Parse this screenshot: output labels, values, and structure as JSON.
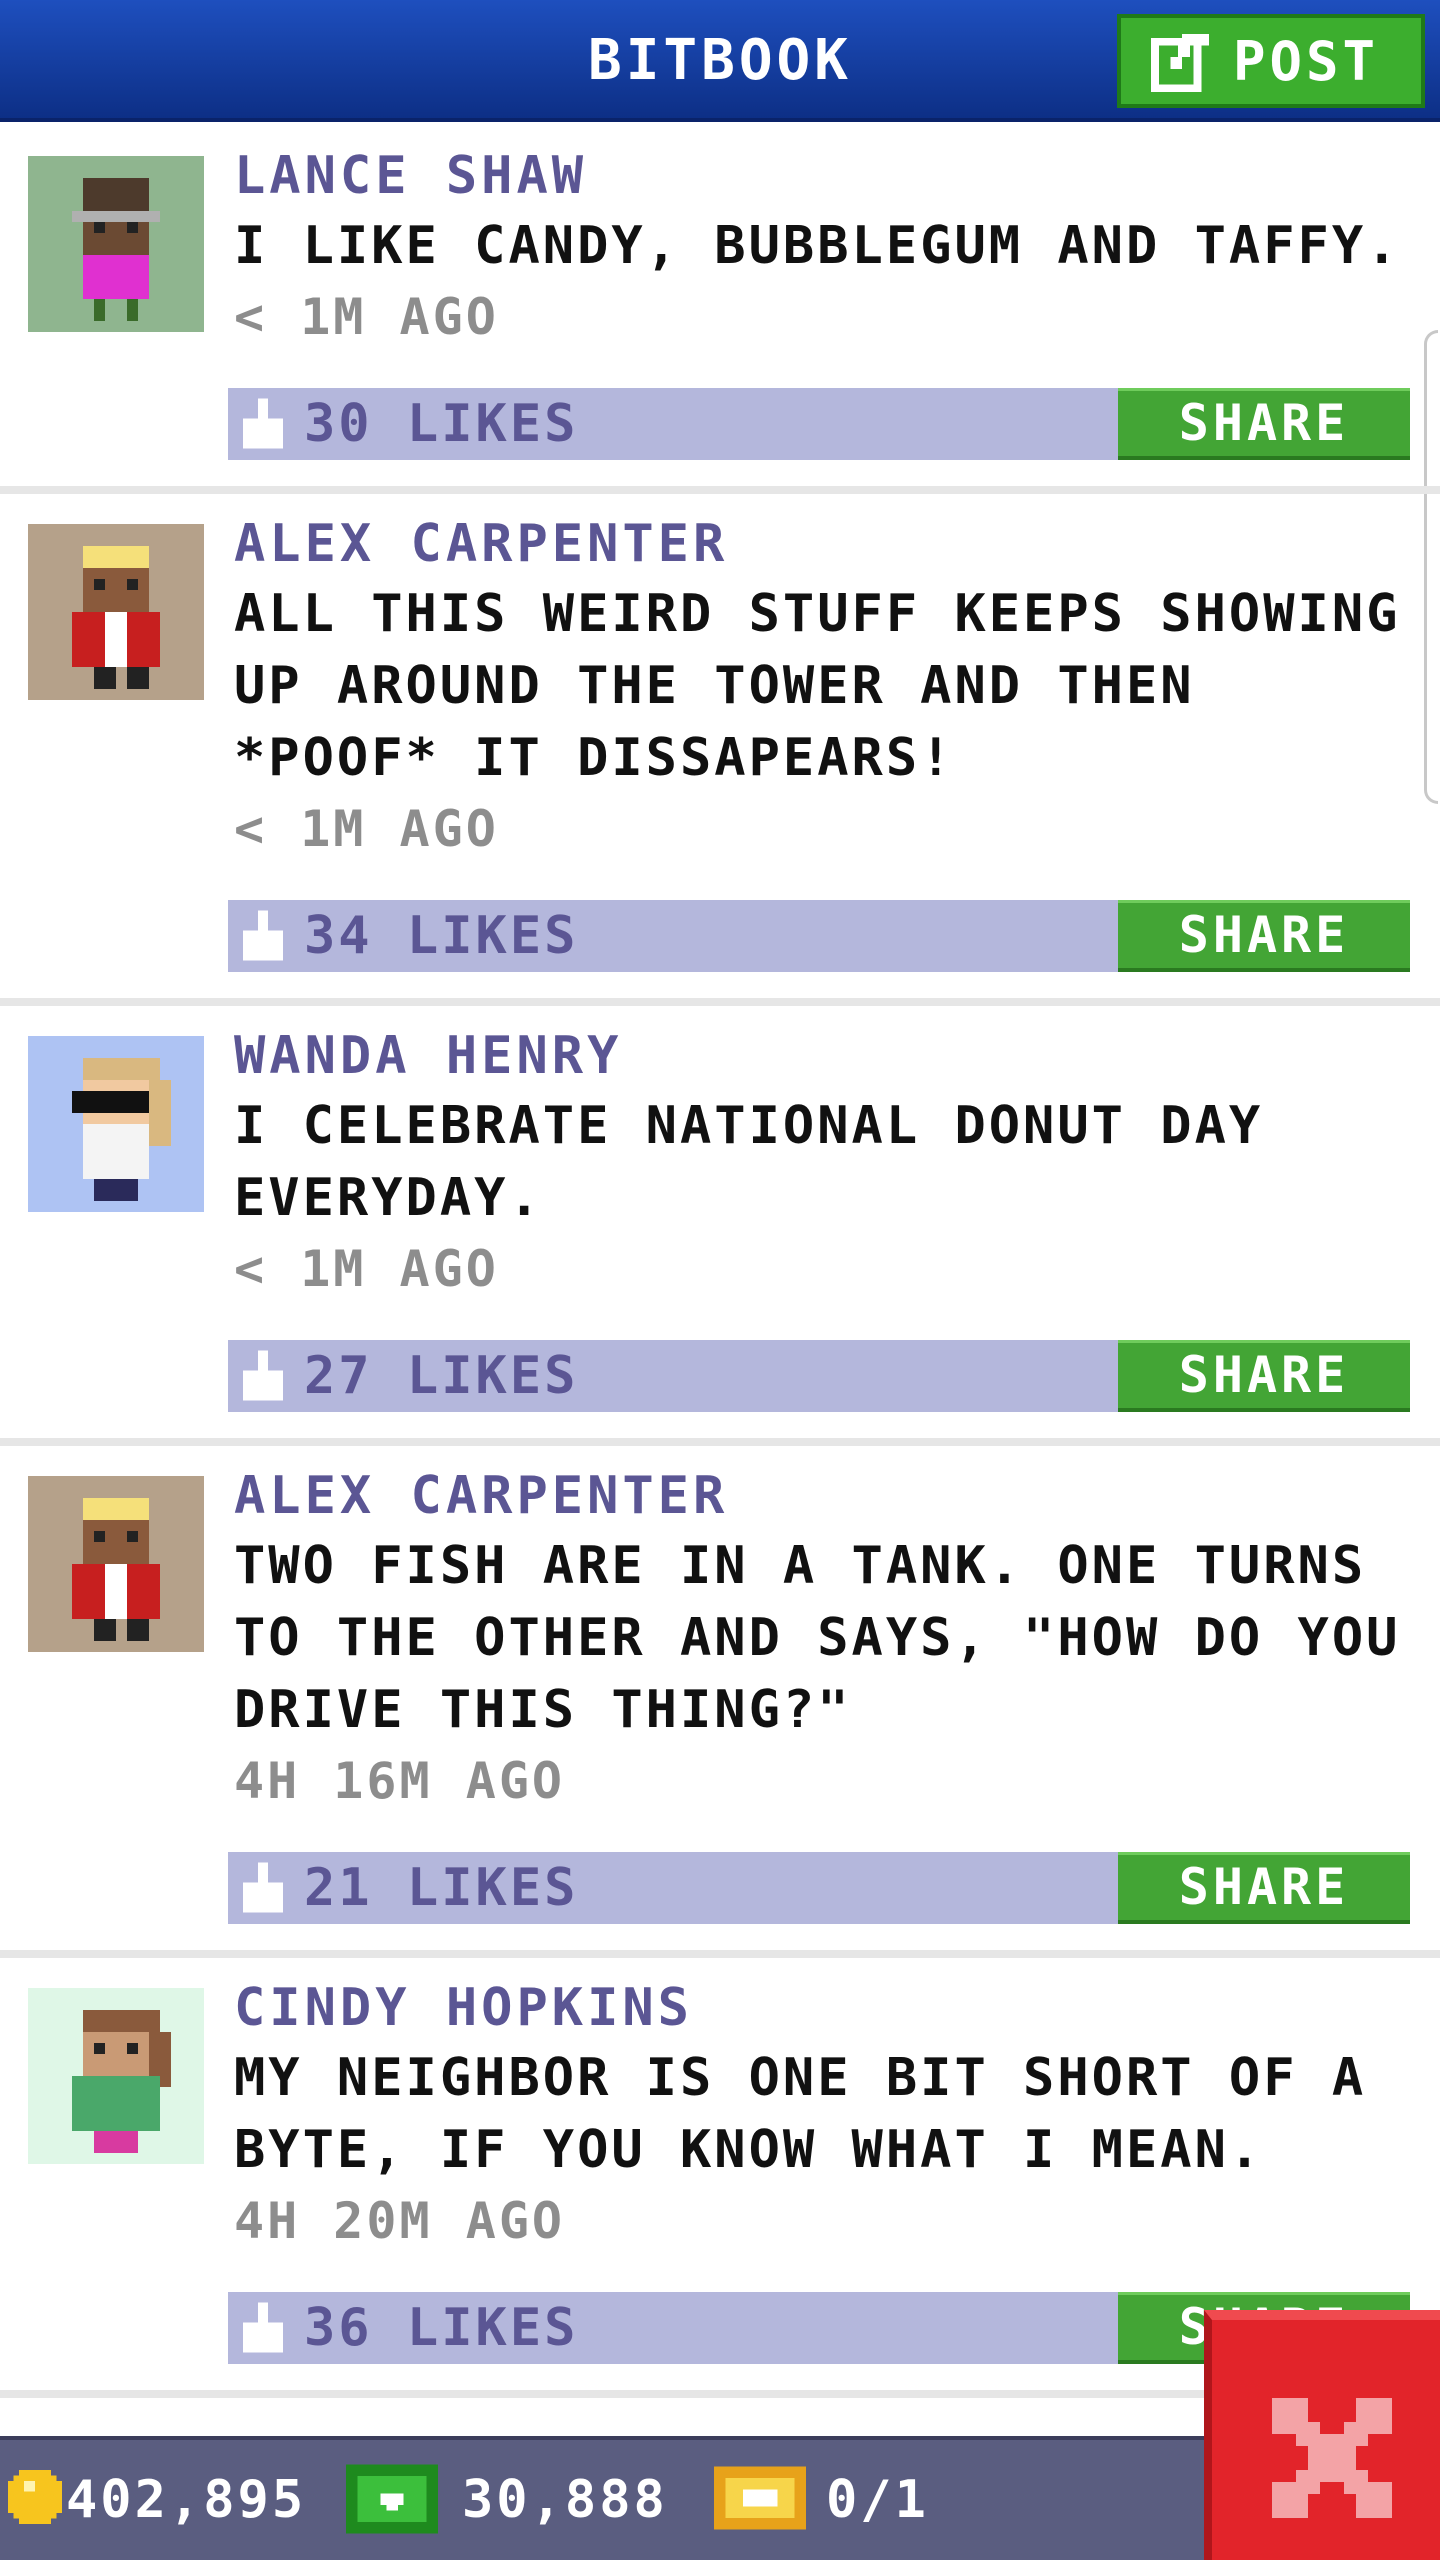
{
  "header": {
    "title": "BITBOOK",
    "post_label": "POST"
  },
  "posts": [
    {
      "author": "LANCE SHAW",
      "message": "I LIKE CANDY, BUBBLEGUM AND TAFFY.",
      "time": "< 1M AGO",
      "likes": "30 LIKES",
      "share": "SHARE",
      "avatar_bg": "#8fb58f"
    },
    {
      "author": "ALEX CARPENTER",
      "message": "ALL THIS WEIRD STUFF KEEPS SHOWING UP AROUND THE TOWER AND THEN *POOF* IT DISSAPEARS!",
      "time": "< 1M AGO",
      "likes": "34 LIKES",
      "share": "SHARE",
      "avatar_bg": "#b5a18a"
    },
    {
      "author": "WANDA HENRY",
      "message": "I CELEBRATE NATIONAL DONUT DAY EVERYDAY.",
      "time": "< 1M AGO",
      "likes": "27 LIKES",
      "share": "SHARE",
      "avatar_bg": "#aec3f3"
    },
    {
      "author": "ALEX CARPENTER",
      "message": "TWO FISH ARE IN A TANK. ONE TURNS TO THE OTHER AND SAYS, \"HOW DO YOU DRIVE THIS THING?\"",
      "time": "4H 16M AGO",
      "likes": "21 LIKES",
      "share": "SHARE",
      "avatar_bg": "#b5a18a"
    },
    {
      "author": "CINDY HOPKINS",
      "message": "MY NEIGHBOR IS ONE BIT SHORT OF A BYTE, IF YOU KNOW WHAT I MEAN.",
      "time": "4H 20M AGO",
      "likes": "36 LIKES",
      "share": "SHARE",
      "avatar_bg": "#dff7e7"
    }
  ],
  "footer": {
    "coins": "402,895",
    "bux": "30,888",
    "tickets": "0/1"
  },
  "colors": {
    "header_blue": "#1e4fbe",
    "share_green": "#43a535",
    "like_bar": "#b4b7dc",
    "close_red": "#e2242a"
  }
}
